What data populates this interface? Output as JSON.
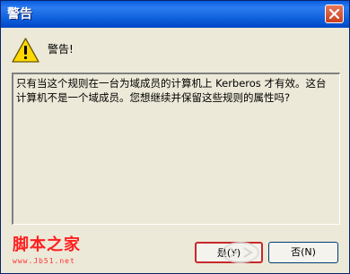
{
  "window": {
    "title": "警告"
  },
  "dialog": {
    "heading": "警告!",
    "message": "只有当这个规则在一台为域成员的计算机上 Kerberos 才有效。这台计算机不是一个域成员。您想继续并保留这些规则的属性吗?"
  },
  "buttons": {
    "yes_label": "是(Y)",
    "no_label": "否(N)"
  },
  "watermark": {
    "site_name": "脚本之家",
    "url": "www.Jb51.net"
  },
  "colors": {
    "titlebar": "#0a5ce0",
    "dialog_bg": "#ece9d8",
    "watermark_red": "#ff2020"
  }
}
